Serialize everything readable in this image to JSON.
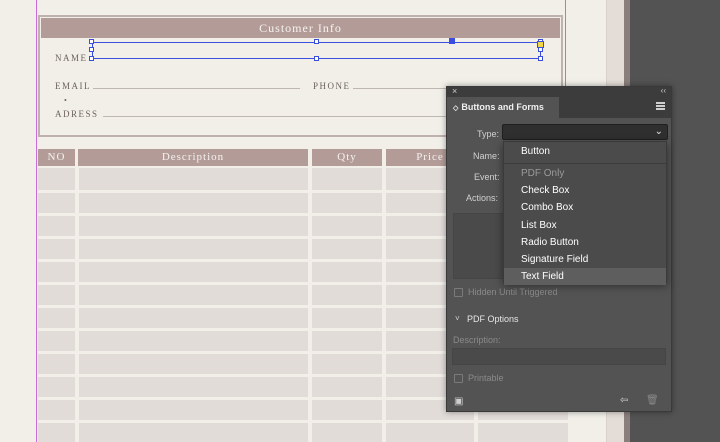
{
  "document": {
    "customer_info": {
      "header": "Customer Info",
      "name_label": "NAME",
      "email_label": "EMAIL",
      "phone_label": "PHONE",
      "address_label": "ADRESS"
    },
    "table": {
      "columns": [
        "NO",
        "Description",
        "Qty",
        "Price"
      ]
    }
  },
  "panel": {
    "title": "Buttons and Forms",
    "close_icon": "close-icon",
    "collapse_glyph": "‹‹",
    "tab_glyph": "◇",
    "type_label": "Type:",
    "type_value": "",
    "name_label": "Name:",
    "event_label": "Event:",
    "actions_label": "Actions:",
    "hidden_label": "Hidden Until Triggered",
    "pdf_options_label": "PDF Options",
    "description_label": "Description:",
    "printable_label": "Printable",
    "dropdown": {
      "items": [
        {
          "label": "Button",
          "enabled": true,
          "highlighted": false
        },
        {
          "label": "PDF Only",
          "enabled": false,
          "highlighted": false
        },
        {
          "label": "Check Box",
          "enabled": true,
          "highlighted": false
        },
        {
          "label": "Combo Box",
          "enabled": true,
          "highlighted": false
        },
        {
          "label": "List Box",
          "enabled": true,
          "highlighted": false
        },
        {
          "label": "Radio Button",
          "enabled": true,
          "highlighted": false
        },
        {
          "label": "Signature Field",
          "enabled": true,
          "highlighted": false
        },
        {
          "label": "Text Field",
          "enabled": true,
          "highlighted": true
        }
      ]
    }
  },
  "colors": {
    "accent_header": "#b39c98",
    "selection": "#3a4fe0",
    "panel_bg": "#535353"
  }
}
